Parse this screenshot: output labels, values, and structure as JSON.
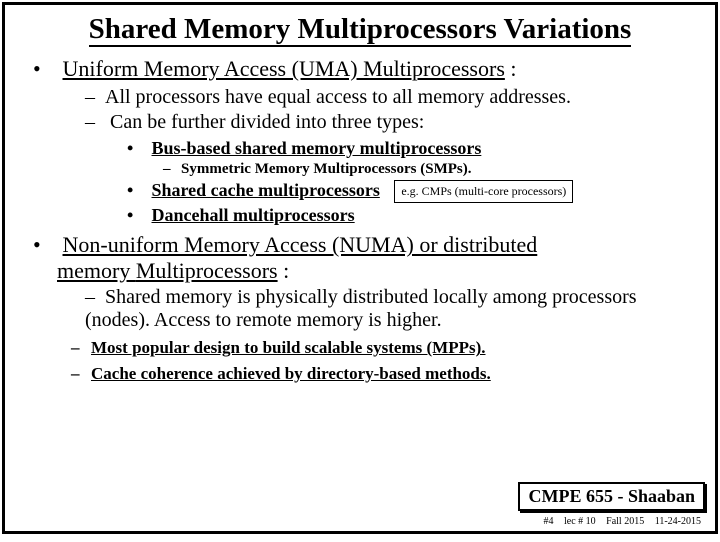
{
  "title": "Shared Memory Multiprocessors Variations",
  "uma": {
    "head": "Uniform Memory Access (UMA) Multiprocessors",
    "tail": " :",
    "sub": [
      "All processors have equal access to all memory addresses.",
      "Can be further divided into three types:"
    ],
    "types": {
      "bus": "Bus-based shared memory multiprocessors",
      "bus_sub": "Symmetric Memory Multiprocessors (SMPs).",
      "shared": "Shared cache multiprocessors",
      "shared_note": "e.g. CMPs (multi-core processors)",
      "dance": "Dancehall multiprocessors"
    }
  },
  "numa": {
    "head_a": "Non-uniform Memory Access (NUMA) or distributed",
    "head_b1": "memory ",
    "head_b2": "Multiprocessors",
    "head_b3": " :",
    "sub1": "Shared memory is physically distributed locally among processors (nodes).  Access to remote memory is higher.",
    "sub2": "Most popular design to build scalable systems (MPPs).",
    "sub3": "Cache coherence achieved by directory-based methods."
  },
  "footer": {
    "course": "CMPE 655 - Shaaban",
    "page": "#4",
    "lec": "lec # 10",
    "term": "Fall 2015",
    "date": "11-24-2015"
  }
}
